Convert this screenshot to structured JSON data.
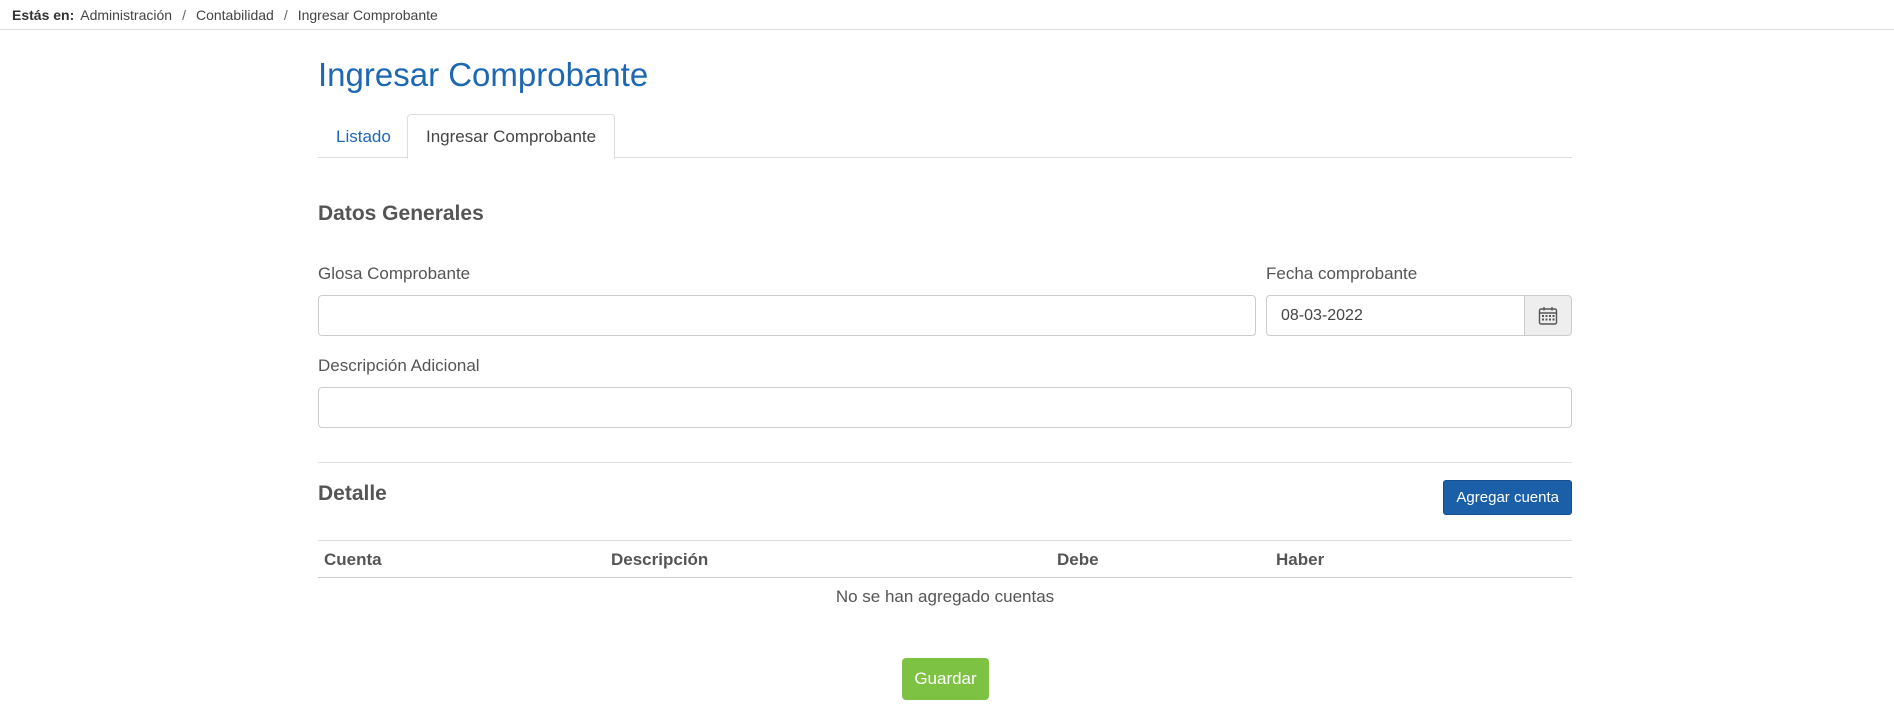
{
  "breadcrumb": {
    "lead": "Estás en:",
    "items": [
      "Administración",
      "Contabilidad",
      "Ingresar Comprobante"
    ],
    "separator": "/"
  },
  "page": {
    "title": "Ingresar Comprobante"
  },
  "tabs": [
    {
      "label": "Listado",
      "active": false
    },
    {
      "label": "Ingresar Comprobante",
      "active": true
    }
  ],
  "datos_generales": {
    "title": "Datos Generales",
    "glosa": {
      "label": "Glosa Comprobante",
      "value": ""
    },
    "fecha": {
      "label": "Fecha comprobante",
      "value": "08-03-2022",
      "icon": "calendar-icon"
    },
    "descripcion": {
      "label": "Descripción Adicional",
      "value": ""
    }
  },
  "detalle": {
    "title": "Detalle",
    "add_button_label": "Agregar cuenta",
    "columns": [
      "Cuenta",
      "Descripción",
      "Debe",
      "Haber"
    ],
    "rows": [],
    "empty_message": "No se han agregado cuentas"
  },
  "actions": {
    "save_label": "Guardar"
  },
  "colors": {
    "title_blue": "#1e68b3",
    "primary_button": "#1a5fa8",
    "save_button": "#7dc243"
  }
}
